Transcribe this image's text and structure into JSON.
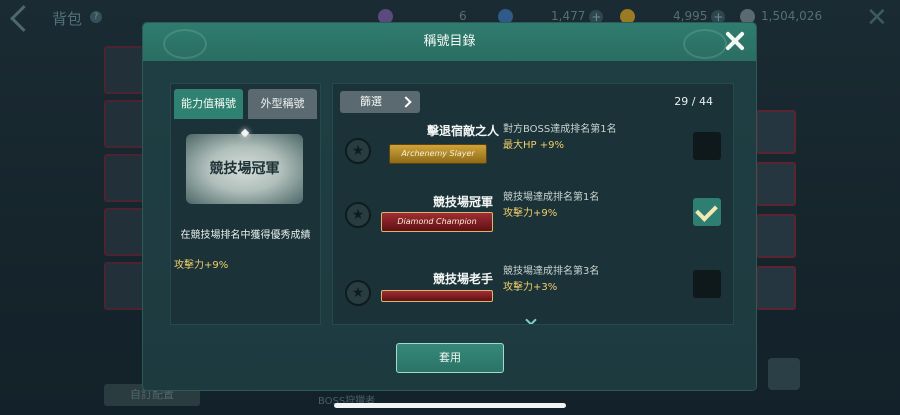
{
  "background": {
    "title": "背包",
    "help": "?",
    "resources": [
      {
        "value": "6",
        "icon": "crystal-icon",
        "color": "#7c6aa8"
      },
      {
        "value": "1,477",
        "icon": "gem-icon",
        "color": "#3a6cb4"
      },
      {
        "value": "4,995",
        "icon": "gold-coin-icon",
        "color": "#c69a2a"
      },
      {
        "value": "1,504,026",
        "icon": "silver-coin-icon",
        "color": "#8a9aa0"
      }
    ],
    "custom_label": "自訂配置",
    "boss_label": "BOSS狩獵者"
  },
  "modal": {
    "title": "稱號目錄",
    "tabs": [
      {
        "label": "能力值稱號",
        "active": true
      },
      {
        "label": "外型稱號",
        "active": false
      }
    ],
    "selected": {
      "name": "競技場冠軍",
      "description": "在競技場排名中獲得優秀成績",
      "effect": "攻擊力+9%"
    },
    "filter_label": "篩選",
    "count": "29 / 44",
    "titles": [
      {
        "name": "擊退宿敵之人",
        "badge": "Archenemy Slayer",
        "badge_style": "gold",
        "description": "對方BOSS達成排名第1名",
        "effect": "最大HP +9%",
        "checked": false
      },
      {
        "name": "競技場冠軍",
        "badge": "Diamond Champion",
        "badge_style": "red",
        "description": "競技場達成排名第1名",
        "effect": "攻擊力+9%",
        "checked": true
      },
      {
        "name": "競技場老手",
        "badge": "",
        "badge_style": "red",
        "description": "競技場達成排名第3名",
        "effect": "攻擊力+3%",
        "checked": false
      }
    ],
    "apply_label": "套用"
  },
  "colors": {
    "header": "#2f7c6f",
    "accent_gold": "#f0ce6a",
    "panel": "#1a3238"
  }
}
